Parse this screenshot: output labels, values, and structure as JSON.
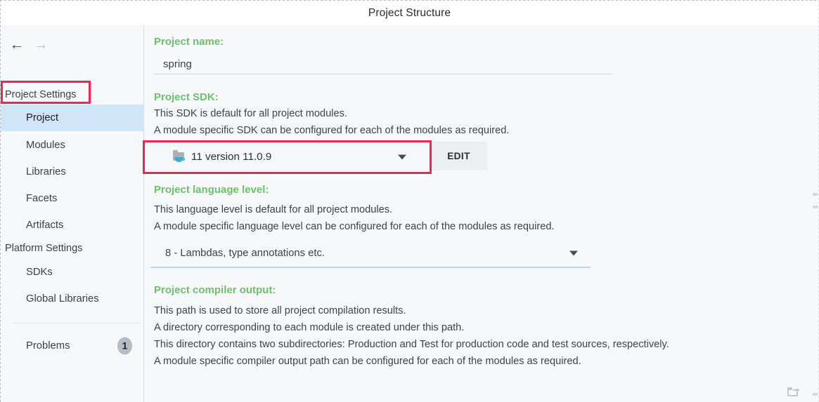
{
  "window": {
    "title": "Project Structure"
  },
  "sidebar": {
    "nav": {
      "back_icon": "arrow-left-icon",
      "forward_icon": "arrow-right-icon",
      "back_glyph": "←",
      "forward_glyph": "→"
    },
    "groups": [
      {
        "label": "Project Settings"
      },
      {
        "label": "Platform Settings"
      }
    ],
    "items": [
      {
        "label": "Project",
        "selected": true
      },
      {
        "label": "Modules",
        "selected": false
      },
      {
        "label": "Libraries",
        "selected": false
      },
      {
        "label": "Facets",
        "selected": false
      },
      {
        "label": "Artifacts",
        "selected": false
      },
      {
        "label": "SDKs",
        "selected": false
      },
      {
        "label": "Global Libraries",
        "selected": false
      },
      {
        "label": "Problems",
        "selected": false,
        "badge": "1"
      }
    ]
  },
  "main": {
    "project_name": {
      "heading": "Project name:",
      "value": "spring"
    },
    "project_sdk": {
      "heading": "Project SDK:",
      "desc_line1": "This SDK is default for all project modules.",
      "desc_line2": "A module specific SDK can be configured for each of the modules as required.",
      "selected": "11 version 11.0.9",
      "icon": "java-sdk-folder-icon",
      "edit_label": "EDIT"
    },
    "language_level": {
      "heading": "Project language level:",
      "desc_line1": "This language level is default for all project modules.",
      "desc_line2": "A module specific language level can be configured for each of the modules as required.",
      "selected": "8 - Lambdas, type annotations etc."
    },
    "compiler_output": {
      "heading": "Project compiler output:",
      "desc_line1": "This path is used to store all project compilation results.",
      "desc_line2": "A directory corresponding to each module is created under this path.",
      "desc_line3": "This directory contains two subdirectories: Production and Test for production code and test sources, respectively.",
      "desc_line4": "A module specific compiler output path can be configured for each of the modules as required.",
      "value": "",
      "browse_icon": "folder-browse-icon"
    }
  },
  "colors": {
    "heading_green": "#6ec06e",
    "selection_blue": "#cfe5f8",
    "annotation_red": "#f22253",
    "sdk_underline_green": "#7fbf4d",
    "field_underline_blue": "#bcd9ee"
  }
}
